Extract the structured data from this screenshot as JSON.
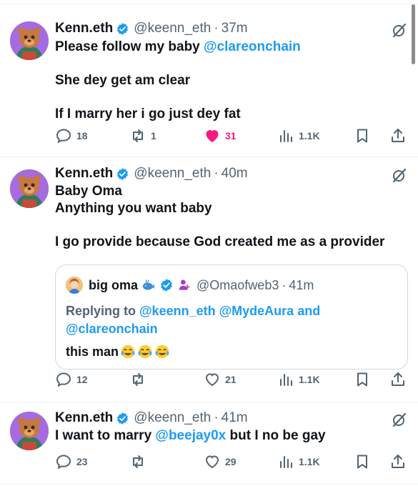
{
  "tweets": [
    {
      "name": "Kenn.eth",
      "handle": "@keenn_eth",
      "dot": "·",
      "time": "37m",
      "line1_prefix": "Please follow my baby ",
      "line1_link": "@clareonchain",
      "line2": "She dey get am clear",
      "line3": "If I marry her i go just dey fat",
      "replies": "18",
      "reposts": "1",
      "likes": "31",
      "views": "1.1K",
      "liked": true
    },
    {
      "name": "Kenn.eth",
      "handle": "@keenn_eth",
      "dot": "·",
      "time": "40m",
      "line1": "Baby Oma",
      "line2": "Anything you want baby",
      "line3": "I go provide because God created me as a provider",
      "quote": {
        "name": "big oma",
        "handle": "@Omaofweb3",
        "dot": "·",
        "time": "41m",
        "reply_prefix": "Replying to ",
        "reply_link1": "@keenn_eth",
        "reply_link2": "@MydeAura",
        "reply_and": " and",
        "reply_link3": "@clareonchain",
        "text": "this man"
      },
      "replies": "12",
      "reposts": "",
      "likes": "21",
      "views": "1.1K",
      "liked": false
    },
    {
      "name": "Kenn.eth",
      "handle": "@keenn_eth",
      "dot": "·",
      "time": "41m",
      "line1_prefix": "I want to marry ",
      "line1_link": "@beejay0x",
      "line1_suffix": " but I no be gay",
      "replies": "23",
      "reposts": "",
      "likes": "29",
      "views": "1.1K",
      "liked": false
    }
  ],
  "icons": {
    "verified": "verified-badge-icon",
    "grok": "grok-icon",
    "reply": "reply-icon",
    "repost": "repost-icon",
    "like": "heart-icon",
    "views": "views-icon",
    "bookmark": "bookmark-icon",
    "share": "share-icon"
  },
  "colors": {
    "link": "#1d9bf0",
    "liked": "#f91880",
    "muted": "#536471"
  }
}
